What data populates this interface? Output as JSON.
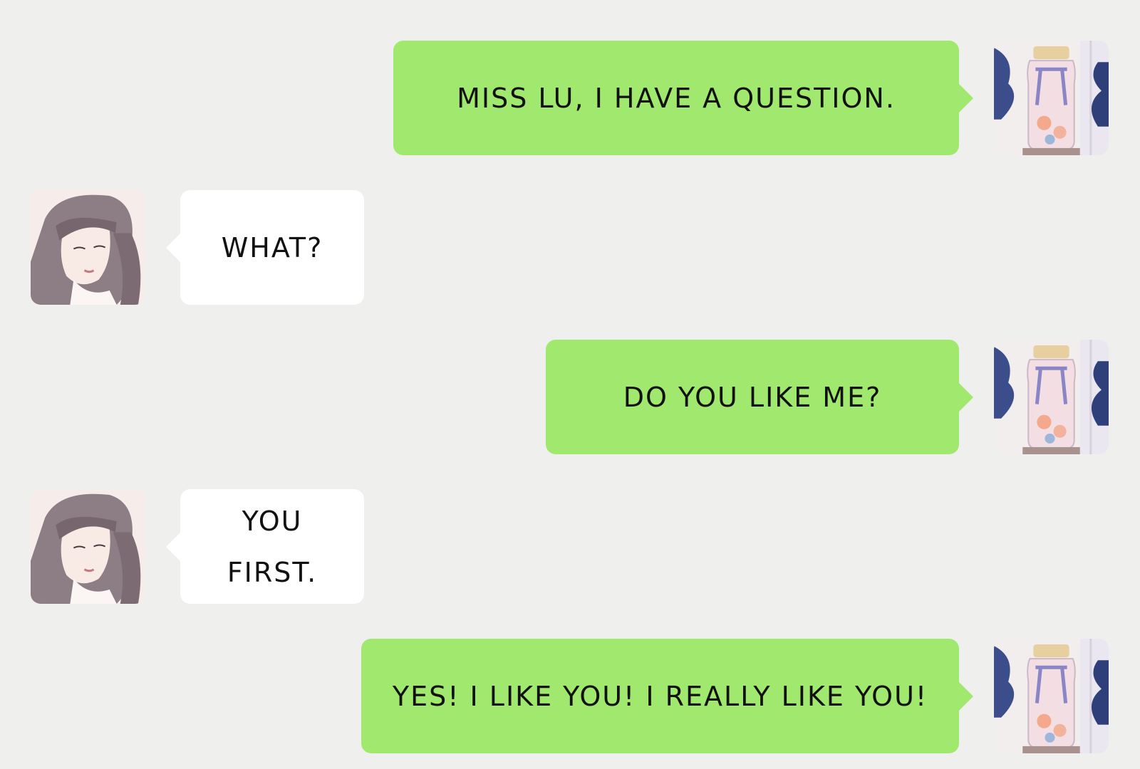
{
  "colors": {
    "background": "#efefed",
    "outgoing_bubble": "#a0e86e",
    "incoming_bubble": "#ffffff",
    "text": "#111111"
  },
  "messages": [
    {
      "side": "right",
      "text": "MISS LU, I HAVE A QUESTION.",
      "avatar": "jar-avatar-icon"
    },
    {
      "side": "left",
      "text": "WHAT?",
      "avatar": "woman-avatar-icon"
    },
    {
      "side": "right",
      "text": "DO YOU LIKE ME?",
      "avatar": "jar-avatar-icon"
    },
    {
      "side": "left",
      "text": "YOU FIRST.",
      "avatar": "woman-avatar-icon"
    },
    {
      "side": "right",
      "text": "YES! I LIKE YOU! I REALLY LIKE YOU!",
      "avatar": "jar-avatar-icon"
    }
  ]
}
